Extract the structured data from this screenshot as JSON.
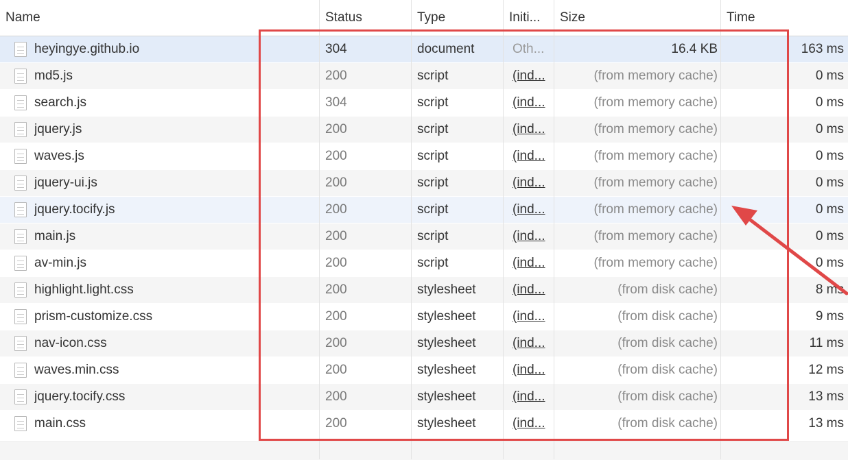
{
  "columns": {
    "name": "Name",
    "status": "Status",
    "type": "Type",
    "initiator": "Initi...",
    "size": "Size",
    "time": "Time"
  },
  "requests": [
    {
      "name": "heyingye.github.io",
      "status": "304",
      "type": "document",
      "initiator": "Oth...",
      "size": "16.4 KB",
      "time": "163 ms"
    },
    {
      "name": "md5.js",
      "status": "200",
      "type": "script",
      "initiator": "(ind...",
      "size": "(from memory cache)",
      "time": "0 ms"
    },
    {
      "name": "search.js",
      "status": "304",
      "type": "script",
      "initiator": "(ind...",
      "size": "(from memory cache)",
      "time": "0 ms"
    },
    {
      "name": "jquery.js",
      "status": "200",
      "type": "script",
      "initiator": "(ind...",
      "size": "(from memory cache)",
      "time": "0 ms"
    },
    {
      "name": "waves.js",
      "status": "200",
      "type": "script",
      "initiator": "(ind...",
      "size": "(from memory cache)",
      "time": "0 ms"
    },
    {
      "name": "jquery-ui.js",
      "status": "200",
      "type": "script",
      "initiator": "(ind...",
      "size": "(from memory cache)",
      "time": "0 ms"
    },
    {
      "name": "jquery.tocify.js",
      "status": "200",
      "type": "script",
      "initiator": "(ind...",
      "size": "(from memory cache)",
      "time": "0 ms"
    },
    {
      "name": "main.js",
      "status": "200",
      "type": "script",
      "initiator": "(ind...",
      "size": "(from memory cache)",
      "time": "0 ms"
    },
    {
      "name": "av-min.js",
      "status": "200",
      "type": "script",
      "initiator": "(ind...",
      "size": "(from memory cache)",
      "time": "0 ms"
    },
    {
      "name": "highlight.light.css",
      "status": "200",
      "type": "stylesheet",
      "initiator": "(ind...",
      "size": "(from disk cache)",
      "time": "8 ms"
    },
    {
      "name": "prism-customize.css",
      "status": "200",
      "type": "stylesheet",
      "initiator": "(ind...",
      "size": "(from disk cache)",
      "time": "9 ms"
    },
    {
      "name": "nav-icon.css",
      "status": "200",
      "type": "stylesheet",
      "initiator": "(ind...",
      "size": "(from disk cache)",
      "time": "11 ms"
    },
    {
      "name": "waves.min.css",
      "status": "200",
      "type": "stylesheet",
      "initiator": "(ind...",
      "size": "(from disk cache)",
      "time": "12 ms"
    },
    {
      "name": "jquery.tocify.css",
      "status": "200",
      "type": "stylesheet",
      "initiator": "(ind...",
      "size": "(from disk cache)",
      "time": "13 ms"
    },
    {
      "name": "main.css",
      "status": "200",
      "type": "stylesheet",
      "initiator": "(ind...",
      "size": "(from disk cache)",
      "time": "13 ms"
    }
  ],
  "selected_row": "heyingye.github.io",
  "hovered_row": "jquery.tocify.js",
  "icons": {
    "file": "file-icon"
  },
  "colors": {
    "annotation": "#e04848",
    "selected_row": "#e3ecf9",
    "alt_row": "#f5f5f5"
  }
}
